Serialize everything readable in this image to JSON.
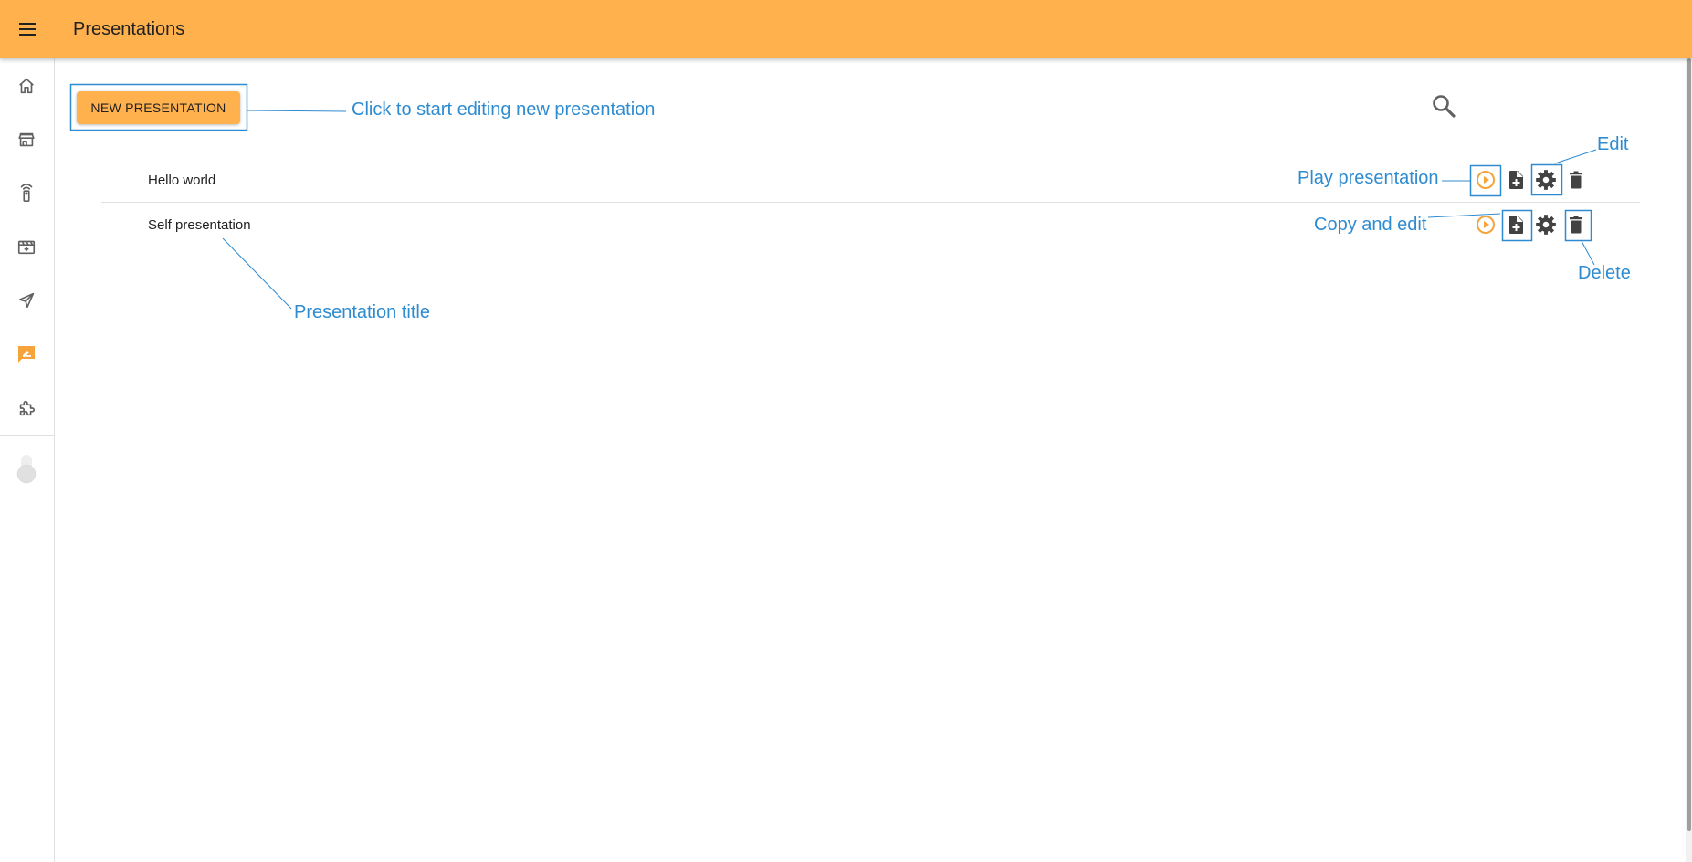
{
  "appbar": {
    "title": "Presentations",
    "menu_icon": "menu-icon",
    "color": "#ffb14e"
  },
  "sidebar": {
    "items": [
      {
        "icon": "home-icon",
        "active": false
      },
      {
        "icon": "store-icon",
        "active": false
      },
      {
        "icon": "remote-device-icon",
        "active": false
      },
      {
        "icon": "media-icon",
        "active": false
      },
      {
        "icon": "send-icon",
        "active": false
      },
      {
        "icon": "presentation-edit-icon",
        "active": true
      },
      {
        "icon": "extension-icon",
        "active": false
      }
    ],
    "active_color": "#f5a33a",
    "toggle_state": "off"
  },
  "toolbar": {
    "new_presentation_label": "NEW PRESENTATION"
  },
  "search": {
    "value": "",
    "placeholder": "",
    "icon": "search-icon"
  },
  "presentations": [
    {
      "title": "Hello world"
    },
    {
      "title": "Self presentation"
    }
  ],
  "row_actions": [
    {
      "action": "play",
      "icon": "play-circle-icon",
      "color": "#f5a33a"
    },
    {
      "action": "copy",
      "icon": "file-plus-icon",
      "color": "#424242"
    },
    {
      "action": "edit",
      "icon": "gear-icon",
      "color": "#424242"
    },
    {
      "action": "delete",
      "icon": "trash-icon",
      "color": "#424242"
    }
  ],
  "annotations": {
    "new_presentation": "Click to start editing new presentation",
    "edit": "Edit",
    "play": "Play presentation",
    "copy": "Copy and edit",
    "delete": "Delete",
    "title": "Presentation title",
    "color": "#2e8bd0"
  }
}
